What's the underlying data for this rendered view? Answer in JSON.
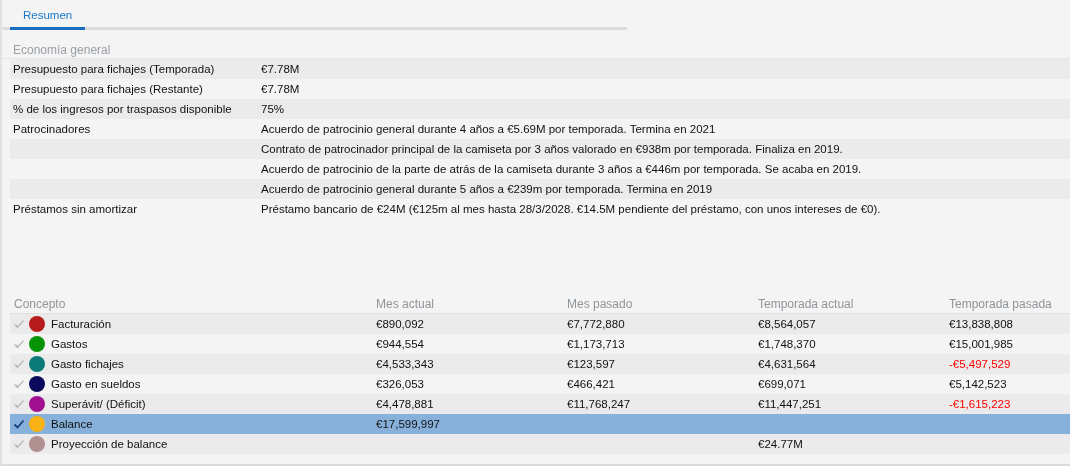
{
  "tabs": [
    {
      "label": "Resumen",
      "selected": true
    }
  ],
  "economy": {
    "title": "Economía general",
    "rows": [
      {
        "label": "Presupuesto para fichajes (Temporada)",
        "values": [
          "€7.78M"
        ]
      },
      {
        "label": "Presupuesto para fichajes (Restante)",
        "values": [
          "€7.78M"
        ]
      },
      {
        "label": "% de los ingresos por traspasos disponible",
        "values": [
          "75%"
        ]
      },
      {
        "label": "Patrocinadores",
        "values": [
          "Acuerdo de patrocinio general durante 4 años a €5.69M por temporada. Termina en 2021",
          "Contrato de patrocinador principal de la camiseta por 3 años valorado en €938m por temporada. Finaliza en 2019.",
          "Acuerdo de patrocinio de la parte de atrás de la camiseta durante 3 años a €446m por temporada. Se acaba en 2019.",
          "Acuerdo de patrocinio general durante 5 años a €239m por temporada. Termina en 2019"
        ]
      },
      {
        "label": "Préstamos sin amortizar",
        "values": [
          "Préstamo bancario de €24M (€125m al mes hasta 28/3/2028. €14.5M pendiente del préstamo, con unos intereses de €0)."
        ]
      }
    ]
  },
  "table": {
    "columns": [
      "Concepto",
      "Mes actual",
      "Mes pasado",
      "Temporada actual",
      "Temporada pasada"
    ],
    "rows": [
      {
        "color": "#b71c1c",
        "checked": false,
        "selected": false,
        "cells": [
          {
            "text": "Facturación",
            "negative": false
          },
          {
            "text": "€890,092",
            "negative": false
          },
          {
            "text": "€7,772,880",
            "negative": false
          },
          {
            "text": "€8,564,057",
            "negative": false
          },
          {
            "text": "€13,838,808",
            "negative": false
          }
        ]
      },
      {
        "color": "#079307",
        "checked": false,
        "selected": false,
        "cells": [
          {
            "text": "Gastos",
            "negative": false
          },
          {
            "text": "€944,554",
            "negative": false
          },
          {
            "text": "€1,173,713",
            "negative": false
          },
          {
            "text": "€1,748,370",
            "negative": false
          },
          {
            "text": "€15,001,985",
            "negative": false
          }
        ]
      },
      {
        "color": "#0a7b78",
        "checked": false,
        "selected": false,
        "cells": [
          {
            "text": "Gasto fichajes",
            "negative": false
          },
          {
            "text": "€4,533,343",
            "negative": false
          },
          {
            "text": "€123,597",
            "negative": false
          },
          {
            "text": "€4,631,564",
            "negative": false
          },
          {
            "text": "-€5,497,529",
            "negative": true
          }
        ]
      },
      {
        "color": "#0a0a5c",
        "checked": false,
        "selected": false,
        "cells": [
          {
            "text": "Gasto en sueldos",
            "negative": false
          },
          {
            "text": "€326,053",
            "negative": false
          },
          {
            "text": "€466,421",
            "negative": false
          },
          {
            "text": "€699,071",
            "negative": false
          },
          {
            "text": "€5,142,523",
            "negative": false
          }
        ]
      },
      {
        "color": "#a0108f",
        "checked": false,
        "selected": false,
        "cells": [
          {
            "text": "Superávit/ (Déficit)",
            "negative": false
          },
          {
            "text": "€4,478,881",
            "negative": false
          },
          {
            "text": "€11,768,247",
            "negative": false
          },
          {
            "text": "€11,447,251",
            "negative": false
          },
          {
            "text": "-€1,615,223",
            "negative": true
          }
        ]
      },
      {
        "color": "#fbb216",
        "checked": true,
        "selected": true,
        "cells": [
          {
            "text": "Balance",
            "negative": false
          },
          {
            "text": "€17,599,997",
            "negative": false
          },
          "",
          "",
          ""
        ]
      },
      {
        "color": "#b09090",
        "checked": false,
        "selected": false,
        "cells": [
          {
            "text": "Proyección de balance",
            "negative": false
          },
          "",
          "",
          {
            "text": "€24.77M",
            "negative": false
          },
          ""
        ]
      }
    ]
  }
}
